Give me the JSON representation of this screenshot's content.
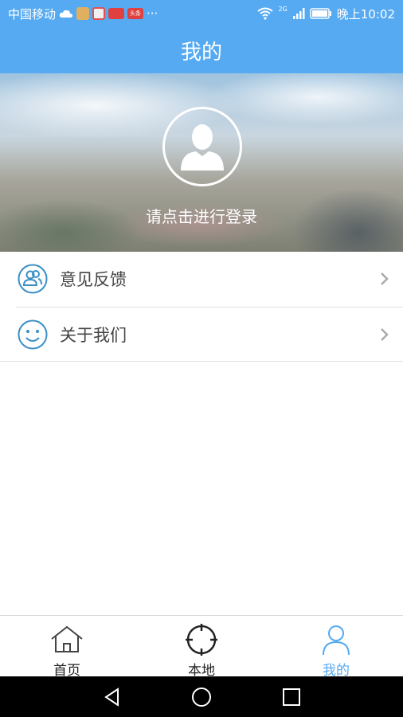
{
  "status_bar": {
    "carrier": "中国移动",
    "app_badge_1": "",
    "app_badge_2": "",
    "app_badge_3": "头条",
    "app_badge_4": "头条",
    "more": "···",
    "network": "2G",
    "time": "晚上10:02"
  },
  "header": {
    "title": "我的"
  },
  "profile": {
    "login_prompt": "请点击进行登录"
  },
  "menu": {
    "items": [
      {
        "label": "意见反馈",
        "icon": "feedback-users-icon"
      },
      {
        "label": "关于我们",
        "icon": "smiley-icon"
      }
    ]
  },
  "bottom_nav": {
    "items": [
      {
        "label": "首页",
        "icon": "home-icon"
      },
      {
        "label": "本地",
        "icon": "crosshair-icon"
      },
      {
        "label": "我的",
        "icon": "person-icon",
        "active": true
      }
    ]
  },
  "colors": {
    "primary": "#56aaf2",
    "text": "#444444",
    "divider": "#e2e2e2"
  }
}
